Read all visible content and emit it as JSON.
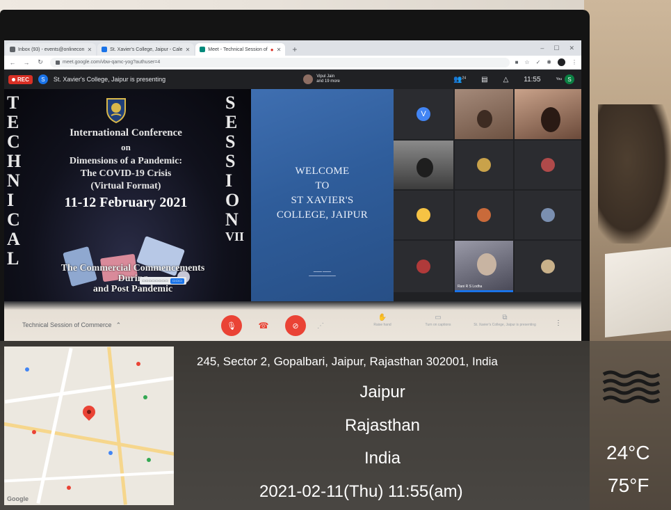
{
  "browser": {
    "tabs": [
      {
        "label": "Inbox (93) - events@onlinecon"
      },
      {
        "label": "St. Xavier's College, Jaipur - Cale"
      },
      {
        "label": "Meet - Technical Session of"
      }
    ],
    "url": "meet.google.com/vbw-qamc-yog?authuser=4"
  },
  "meet": {
    "rec_label": "REC",
    "presenter_initial": "S",
    "presenting_text": "St. Xavier's College, Jaipur is presenting",
    "participants_line1": "Vipul Jain",
    "participants_line2": "and 19 more",
    "participant_count": "24",
    "clock": "11:55",
    "self_initial": "S",
    "self_label": "You",
    "meeting_title": "Technical Session of Commerce",
    "footer": {
      "raise_hand": "Raise hand",
      "captions": "Turn on captions",
      "presenting": "St. Xavier's College, Jaipur is presenting"
    },
    "tile_names": {
      "tile_v": "V",
      "tile_speaker": "Rani R S Lodha"
    }
  },
  "slide": {
    "left_letters": [
      "T",
      "E",
      "C",
      "H",
      "N",
      "I",
      "C",
      "A",
      "L"
    ],
    "right_letters": [
      "S",
      "E",
      "S",
      "S",
      "I",
      "O",
      "N"
    ],
    "session_numeral": "VII",
    "conference_line1": "International Conference",
    "conference_line2": "on",
    "conference_line3": "Dimensions of a Pandemic:",
    "conference_line4": "The COVID-19 Crisis",
    "conference_line5": "(Virtual Format)",
    "conference_dates": "11-12 February 2021",
    "session_subtitle_1": "The Commercial Commencements",
    "session_subtitle_2": "During",
    "session_subtitle_3": "and Post Pandemic",
    "welcome_1": "WELCOME",
    "welcome_2": "TO",
    "welcome_3": "ST XAVIER'S",
    "welcome_4": "COLLEGE, JAIPUR"
  },
  "gps": {
    "address": "245, Sector 2, Gopalbari, Jaipur, Rajasthan 302001, India",
    "city": "Jaipur",
    "state": "Rajasthan",
    "country": "India",
    "datetime": "2021-02-11(Thu)  11:55(am)",
    "temp_c": "24°C",
    "temp_f": "75°F",
    "weather_icon": "haze-icon",
    "map_brand": "Google"
  }
}
